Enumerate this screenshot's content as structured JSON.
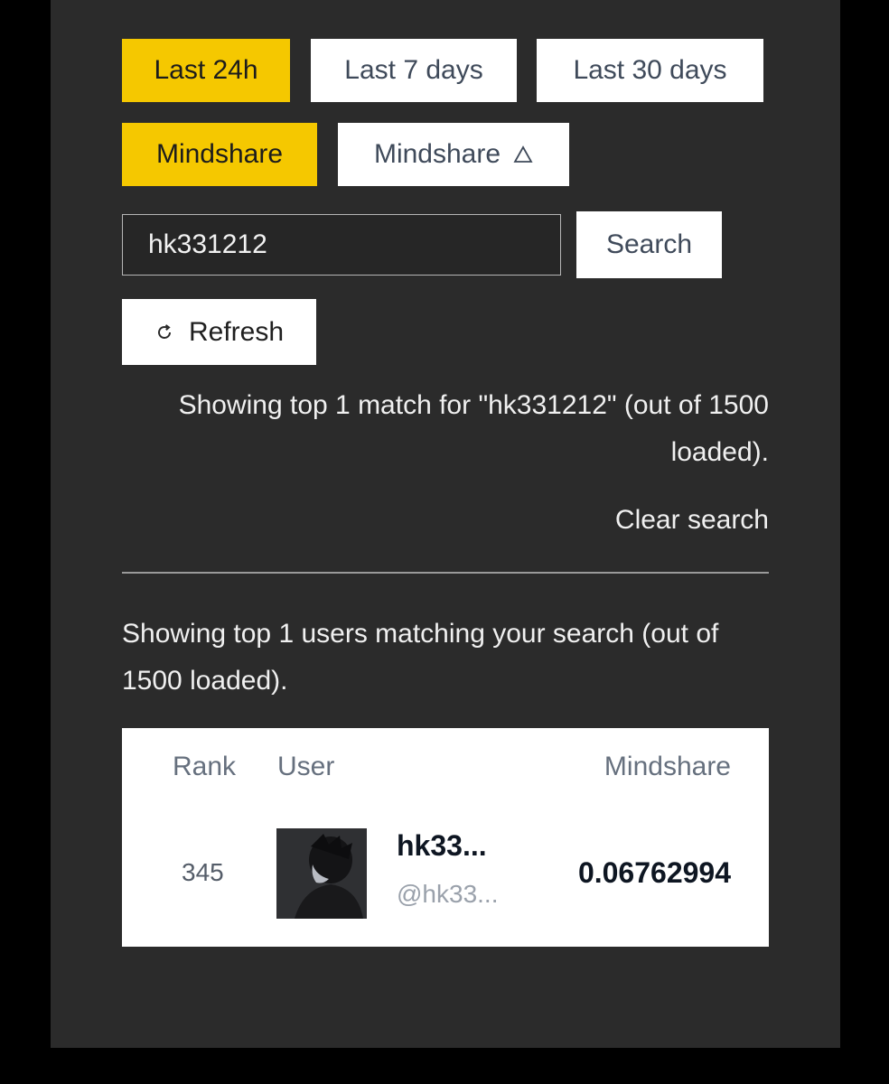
{
  "time_filters": [
    {
      "label": "Last 24h",
      "active": true
    },
    {
      "label": "Last 7 days",
      "active": false
    },
    {
      "label": "Last 30 days",
      "active": false
    }
  ],
  "sort": {
    "metric_label": "Mindshare",
    "order_label": "Mindshare",
    "order_icon": "triangle-up-icon"
  },
  "search": {
    "value": "hk331212",
    "button_label": "Search"
  },
  "refresh": {
    "icon": "refresh-icon",
    "label": "Refresh"
  },
  "search_status": "Showing top 1 match for \"hk331212\" (out of 1500 loaded).",
  "clear_search_label": "Clear search",
  "results_summary": "Showing top 1 users matching your search (out of 1500 loaded).",
  "table": {
    "headers": {
      "rank": "Rank",
      "user": "User",
      "mindshare": "Mindshare"
    },
    "rows": [
      {
        "rank": "345",
        "display_name": "hk33...",
        "handle": "@hk33...",
        "mindshare": "0.06762994"
      }
    ]
  },
  "colors": {
    "accent": "#f5c800",
    "background": "#2b2b2b",
    "page_outer": "#000000"
  }
}
